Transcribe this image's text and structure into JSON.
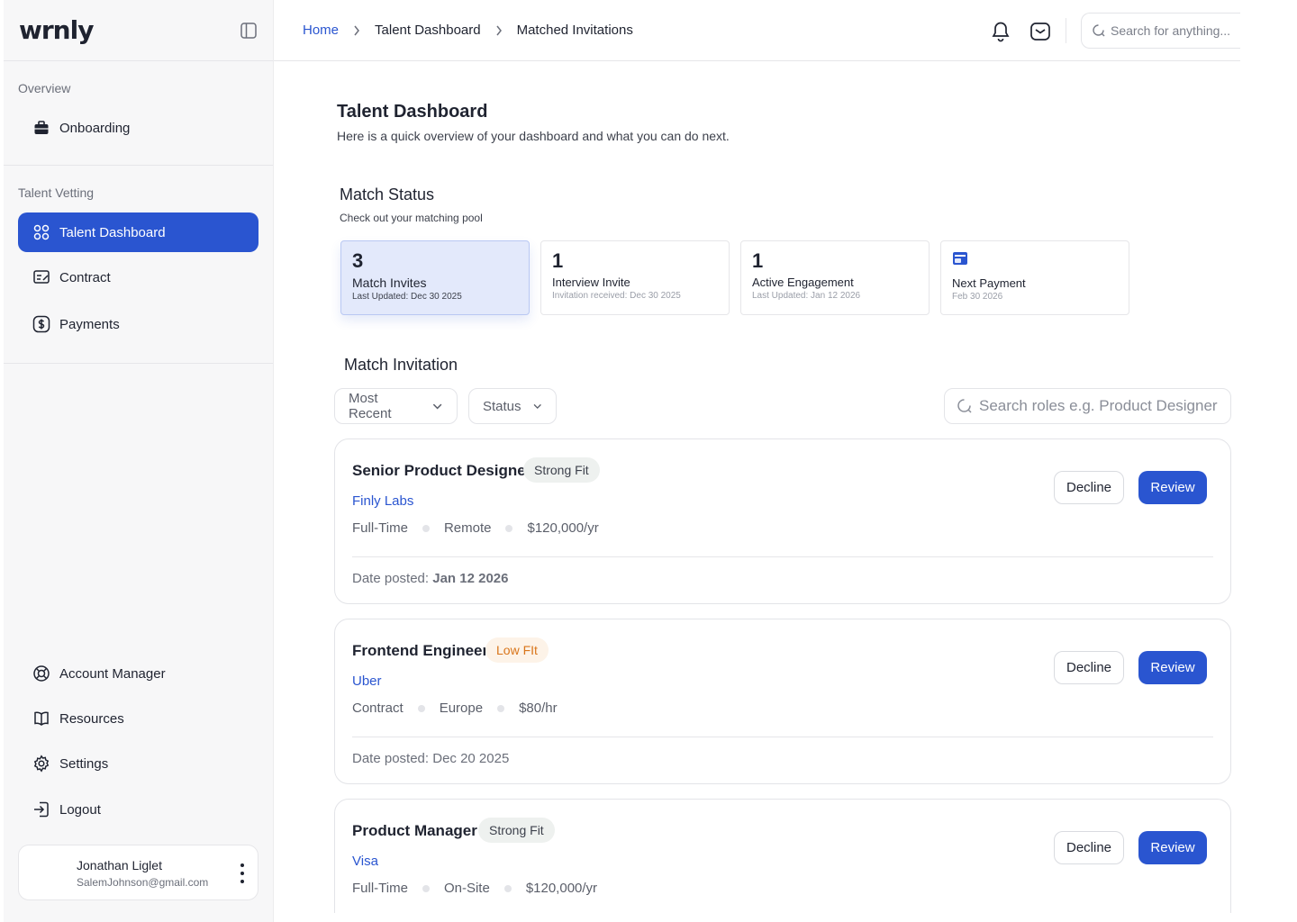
{
  "app": {
    "logo": "wrnly"
  },
  "sidebar": {
    "overview_heading": "Overview",
    "onboarding_label": "Onboarding",
    "vetting_heading": "Talent Vetting",
    "items": [
      {
        "label": "Talent Dashboard",
        "icon": "grid-icon",
        "active": true
      },
      {
        "label": "Contract",
        "icon": "contract-icon"
      },
      {
        "label": "Payments",
        "icon": "dollar-icon"
      }
    ],
    "bottom_items": [
      {
        "label": "Account Manager",
        "icon": "lifebuoy-icon"
      },
      {
        "label": "Resources",
        "icon": "book-icon"
      },
      {
        "label": "Settings",
        "icon": "gear-icon"
      },
      {
        "label": "Logout",
        "icon": "logout-icon"
      }
    ],
    "user": {
      "name": "Jonathan Liglet",
      "email": "SalemJohnson@gmail.com"
    }
  },
  "header": {
    "breadcrumbs": [
      "Home",
      "Talent Dashboard",
      "Matched Invitations"
    ],
    "search_placeholder": "Search for anything..."
  },
  "page": {
    "title": "Talent Dashboard",
    "subtitle": "Here is a quick overview of your dashboard and what you can do next."
  },
  "match_status": {
    "title": "Match Status",
    "subtitle": "Check out your matching pool",
    "cards": [
      {
        "number": "3",
        "label": "Match Invites",
        "meta": "Last Updated: Dec 30 2025"
      },
      {
        "number": "1",
        "label": "Interview Invite",
        "meta": "Invitation received: Dec 30 2025"
      },
      {
        "number": "1",
        "label": "Active Engagement",
        "meta": "Last Updated: Jan 12 2026"
      },
      {
        "label": "Next Payment",
        "meta": "Feb 30 2026"
      }
    ]
  },
  "match_invitation": {
    "title": "Match Invitation",
    "filters": {
      "sort": "Most Recent",
      "status": "Status"
    },
    "search_placeholder": "Search roles e.g. Product Designer",
    "decline_label": "Decline",
    "review_label": "Review",
    "date_prefix": "Date posted: ",
    "jobs": [
      {
        "title": "Senior Product Designer",
        "fit": "Strong Fit",
        "company": "Finly Labs",
        "type": "Full-Time",
        "location": "Remote",
        "pay": "$120,000/yr",
        "date": "Jan 12 2026"
      },
      {
        "title": "Frontend Engineer",
        "fit": "Low FIt",
        "company": "Uber",
        "type": "Contract",
        "location": "Europe",
        "pay": "$80/hr",
        "date": "Dec 20 2025"
      },
      {
        "title": "Product Manager",
        "fit": "Strong Fit",
        "company": "Visa",
        "type": "Full-Time",
        "location": "On-Site",
        "pay": "$120,000/yr",
        "date": ""
      }
    ]
  },
  "colors": {
    "accent": "#2a55d0",
    "low_fit": "#d9751a",
    "active_card_bg": "#e3e9fb"
  }
}
